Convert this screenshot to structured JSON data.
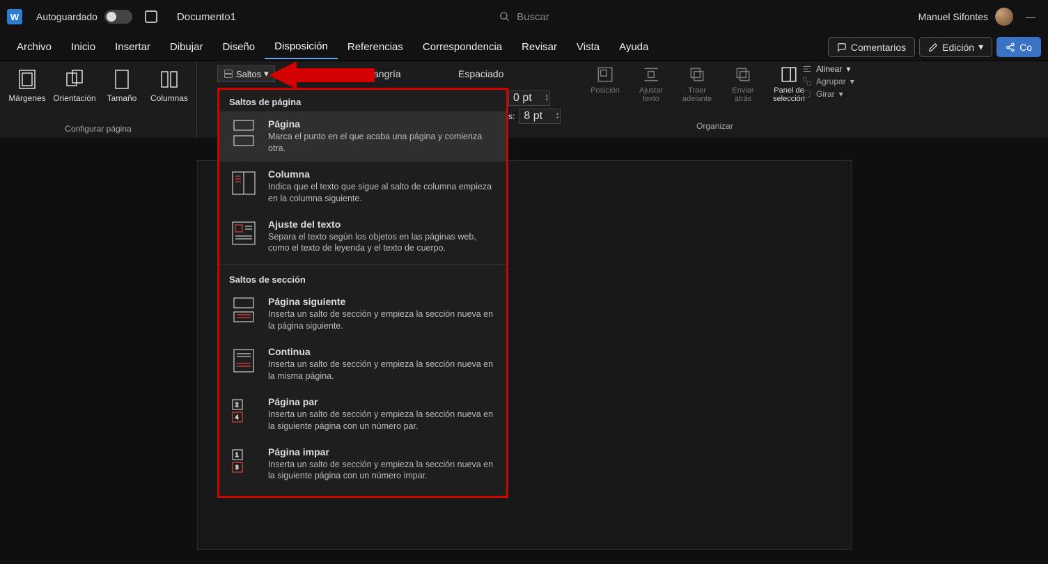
{
  "titlebar": {
    "app_letter": "W",
    "autosave_label": "Autoguardado",
    "doc_title": "Documento1",
    "search_placeholder": "Buscar",
    "user_name": "Manuel Sifontes"
  },
  "tabs": {
    "items": [
      "Archivo",
      "Inicio",
      "Insertar",
      "Dibujar",
      "Diseño",
      "Disposición",
      "Referencias",
      "Correspondencia",
      "Revisar",
      "Vista",
      "Ayuda"
    ],
    "active_index": 5,
    "right": {
      "comments": "Comentarios",
      "edit": "Edición",
      "share": "Co"
    }
  },
  "ribbon": {
    "page_setup": {
      "margins": "Márgenes",
      "orientation": "Orientación",
      "size": "Tamaño",
      "columns": "Columnas",
      "group_label": "Configurar página",
      "breaks_btn": "Saltos"
    },
    "indent_label": "angría",
    "spacing_label": "Espaciado",
    "spacing": {
      "before_value": "0 pt",
      "after_lbl": "s:",
      "after_value": "8 pt"
    },
    "arrange": {
      "position": "Posición",
      "wrap": "Ajustar texto",
      "bring": "Traer adelante",
      "send": "Enviar atrás",
      "pane": "Panel de selección",
      "align": "Alinear",
      "group": "Agrupar",
      "rotate": "Girar",
      "group_label": "Organizar"
    }
  },
  "dropdown": {
    "section1_title": "Saltos de página",
    "section2_title": "Saltos de sección",
    "items1": [
      {
        "title": "Página",
        "desc": "Marca el punto en el que acaba una página y comienza otra."
      },
      {
        "title": "Columna",
        "desc": "Indica que el texto que sigue al salto de columna empieza en la columna siguiente."
      },
      {
        "title": "Ajuste del texto",
        "desc": "Separa el texto según los objetos en las páginas web, como el texto de leyenda y el texto de cuerpo."
      }
    ],
    "items2": [
      {
        "title": "Página siguiente",
        "desc": "Inserta un salto de sección y empieza la sección nueva en la página siguiente."
      },
      {
        "title": "Continua",
        "desc": "Inserta un salto de sección y empieza la sección nueva en la misma página."
      },
      {
        "title": "Página par",
        "desc": "Inserta un salto de sección y empieza la sección nueva en la siguiente página con un número par."
      },
      {
        "title": "Página impar",
        "desc": "Inserta un salto de sección y empieza la sección nueva en la siguiente página con un número impar."
      }
    ]
  }
}
